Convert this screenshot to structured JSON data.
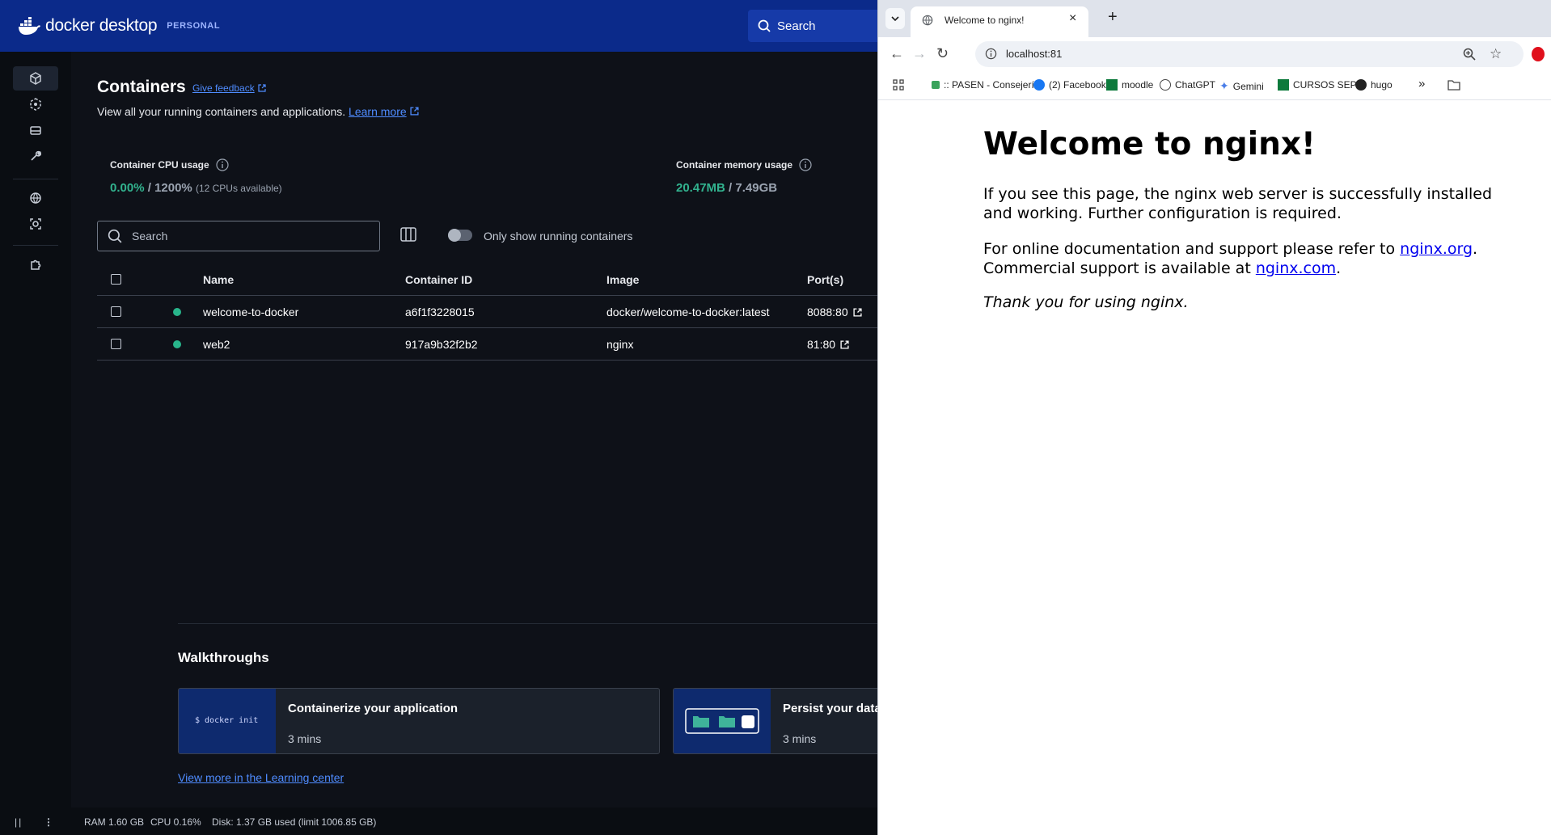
{
  "docker": {
    "brand": "docker desktop",
    "plan": "PERSONAL",
    "top_search": "Search",
    "title": "Containers",
    "feedback": "Give feedback",
    "subtitle": "View all your running containers and applications.",
    "learn_more": "Learn more",
    "cpu": {
      "label": "Container CPU usage",
      "used": "0.00%",
      "sep": " / ",
      "total": "1200%",
      "note": "(12 CPUs available)"
    },
    "mem": {
      "label": "Container memory usage",
      "used": "20.47MB",
      "sep": " / ",
      "total": "7.49GB"
    },
    "search_placeholder": "Search",
    "toggle_label": "Only show running containers",
    "columns": [
      "Name",
      "Container ID",
      "Image",
      "Port(s)"
    ],
    "rows": [
      {
        "name": "welcome-to-docker",
        "id": "a6f1f3228015",
        "image": "docker/welcome-to-docker:latest",
        "port": "8088:80"
      },
      {
        "name": "web2",
        "id": "917a9b32f2b2",
        "image": "nginx",
        "port": "81:80"
      }
    ],
    "walkthroughs": {
      "title": "Walkthroughs",
      "cards": [
        {
          "title": "Containerize your application",
          "duration": "3 mins",
          "thumb_text": "$ docker init"
        },
        {
          "title": "Persist your data",
          "duration": "3 mins"
        }
      ],
      "learning_link": "View more in the Learning center"
    },
    "footer": {
      "ram": "RAM 1.60 GB",
      "cpu": "CPU 0.16%",
      "disk": "Disk: 1.37 GB used (limit 1006.85 GB)"
    }
  },
  "chrome": {
    "tab_title": "Welcome to nginx!",
    "url": "localhost:81",
    "bookmarks": [
      ":: PASEN - Consejerí...",
      "(2) Facebook",
      "moodle",
      "ChatGPT",
      "Gemini",
      "CURSOS SEPE",
      "hugo"
    ],
    "more": "»"
  },
  "nginx": {
    "heading": "Welcome to nginx!",
    "p1": "If you see this page, the nginx web server is successfully installed and working. Further configuration is required.",
    "p2_a": "For online documentation and support please refer to ",
    "link1": "nginx.org",
    "p2_b": ".",
    "p2_c": "Commercial support is available at ",
    "link2": "nginx.com",
    "p2_d": ".",
    "p3": "Thank you for using nginx."
  },
  "colors": {
    "docker_top": "#0b2a8a",
    "accent_green": "#32b38f",
    "link_blue": "#4f8cff"
  }
}
